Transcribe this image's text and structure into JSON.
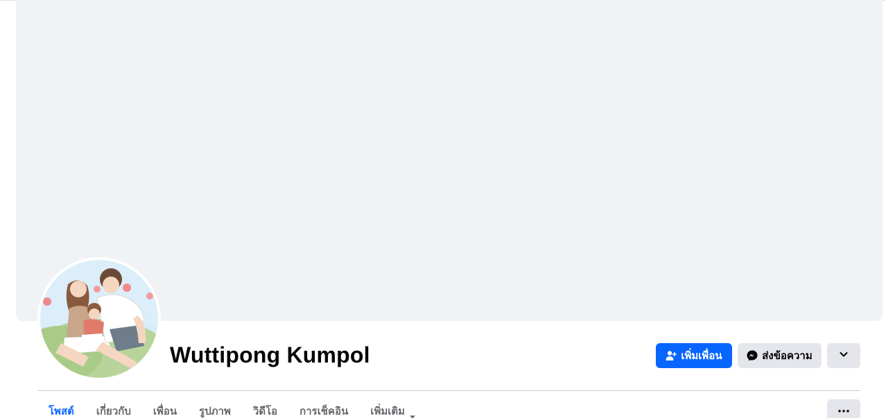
{
  "profile": {
    "name": "Wuttipong Kumpol"
  },
  "actions": {
    "add_friend_label": "เพิ่มเพื่อน",
    "message_label": "ส่งข้อความ"
  },
  "tabs": [
    {
      "label": "โพสต์",
      "active": true
    },
    {
      "label": "เกี่ยวกับ",
      "active": false
    },
    {
      "label": "เพื่อน",
      "active": false
    },
    {
      "label": "รูปภาพ",
      "active": false
    },
    {
      "label": "วิดีโอ",
      "active": false
    },
    {
      "label": "การเช็คอิน",
      "active": false
    },
    {
      "label": "เพิ่มเติม",
      "active": false
    }
  ],
  "colors": {
    "accent": "#0866ff",
    "cover_bg": "#f0f2f5",
    "secondary_button": "#e4e6eb"
  },
  "icons": [
    "add-friend-icon",
    "messenger-icon",
    "chevron-down-icon",
    "caret-down-icon",
    "ellipsis-icon"
  ]
}
